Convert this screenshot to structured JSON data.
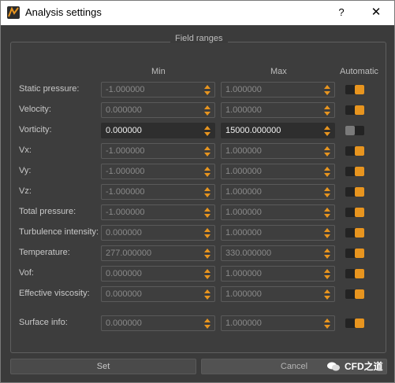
{
  "window": {
    "title": "Analysis settings",
    "help_label": "?",
    "close_label": "✕"
  },
  "group": {
    "title": "Field ranges"
  },
  "columns": {
    "min": "Min",
    "max": "Max",
    "automatic": "Automatic"
  },
  "rows": [
    {
      "label": "Static pressure:",
      "min": "-1.000000",
      "max": "1.000000",
      "automatic": true
    },
    {
      "label": "Velocity:",
      "min": "0.000000",
      "max": "1.000000",
      "automatic": true
    },
    {
      "label": "Vorticity:",
      "min": "0.000000",
      "max": "15000.000000",
      "automatic": false
    },
    {
      "label": "Vx:",
      "min": "-1.000000",
      "max": "1.000000",
      "automatic": true
    },
    {
      "label": "Vy:",
      "min": "-1.000000",
      "max": "1.000000",
      "automatic": true
    },
    {
      "label": "Vz:",
      "min": "-1.000000",
      "max": "1.000000",
      "automatic": true
    },
    {
      "label": "Total pressure:",
      "min": "-1.000000",
      "max": "1.000000",
      "automatic": true
    },
    {
      "label": "Turbulence intensity:",
      "min": "0.000000",
      "max": "1.000000",
      "automatic": true
    },
    {
      "label": "Temperature:",
      "min": "277.000000",
      "max": "330.000000",
      "automatic": true
    },
    {
      "label": "Vof:",
      "min": "0.000000",
      "max": "1.000000",
      "automatic": true
    },
    {
      "label": "Effective viscosity:",
      "min": "0.000000",
      "max": "1.000000",
      "automatic": true
    },
    {
      "label": "Surface info:",
      "min": "0.000000",
      "max": "1.000000",
      "automatic": true
    }
  ],
  "buttons": {
    "set": "Set",
    "cancel": "Cancel"
  },
  "watermark": "CFD之道",
  "colors": {
    "accent": "#e8951f",
    "background": "#3b3b3b"
  }
}
